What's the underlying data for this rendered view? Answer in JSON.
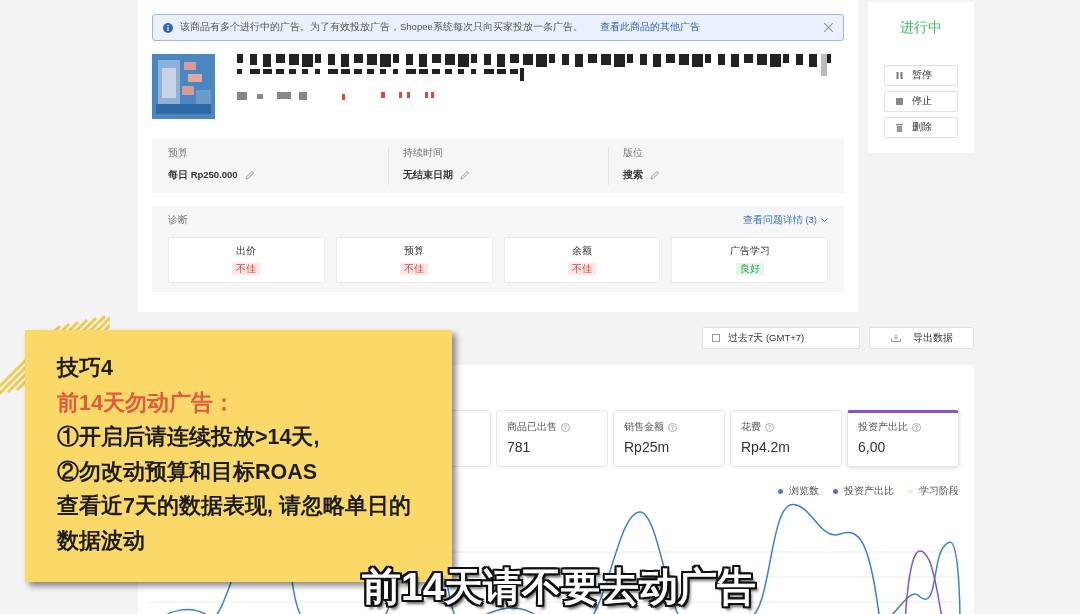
{
  "notice": {
    "text": "该商品有多个进行中的广告。为了有效投放广告，Shopee系统每次只向买家投放一条广告。",
    "link": "查看此商品的其他广告"
  },
  "status": {
    "label": "进行中",
    "actions": [
      {
        "label": "暂停",
        "kind": "pause"
      },
      {
        "label": "停止",
        "kind": "stop"
      },
      {
        "label": "删除",
        "kind": "delete"
      }
    ]
  },
  "settings": [
    {
      "label": "预算",
      "value": "每日 Rp250.000"
    },
    {
      "label": "持续时间",
      "value": "无结束日期"
    },
    {
      "label": "版位",
      "value": "搜索"
    }
  ],
  "diagnosis": {
    "title": "诊断",
    "link": "查看问题详情 (3)",
    "items": [
      {
        "label": "出价",
        "status": "不佳",
        "kind": "bad"
      },
      {
        "label": "预算",
        "status": "不佳",
        "kind": "bad"
      },
      {
        "label": "余额",
        "status": "不佳",
        "kind": "bad"
      },
      {
        "label": "广告学习",
        "status": "良好",
        "kind": "good"
      }
    ]
  },
  "date_range": "过去7天 (GMT+7)",
  "export": "导出数据",
  "metrics": [
    {
      "label": "商品已出售",
      "value": "781",
      "selected": false
    },
    {
      "label": "销售金额",
      "value": "Rp25m",
      "selected": false
    },
    {
      "label": "花费",
      "value": "Rp4.2m",
      "selected": false
    },
    {
      "label": "投资产出比",
      "value": "6,00",
      "selected": true
    }
  ],
  "legend": [
    {
      "label": "浏览数",
      "color": "#3d7fd6"
    },
    {
      "label": "投资产出比",
      "color": "#8a52c4"
    },
    {
      "label": "学习阶段",
      "color": "#f2efd2"
    }
  ],
  "tip": {
    "title": "技巧4",
    "subtitle": "前14天勿动广告：",
    "lines": [
      "①开启后请连续投放>14天,",
      "②勿改动预算和目标ROAS",
      "查看近7天的数据表现, 请忽略单日的数据波动"
    ]
  },
  "caption": "前14天请不要去动广告"
}
